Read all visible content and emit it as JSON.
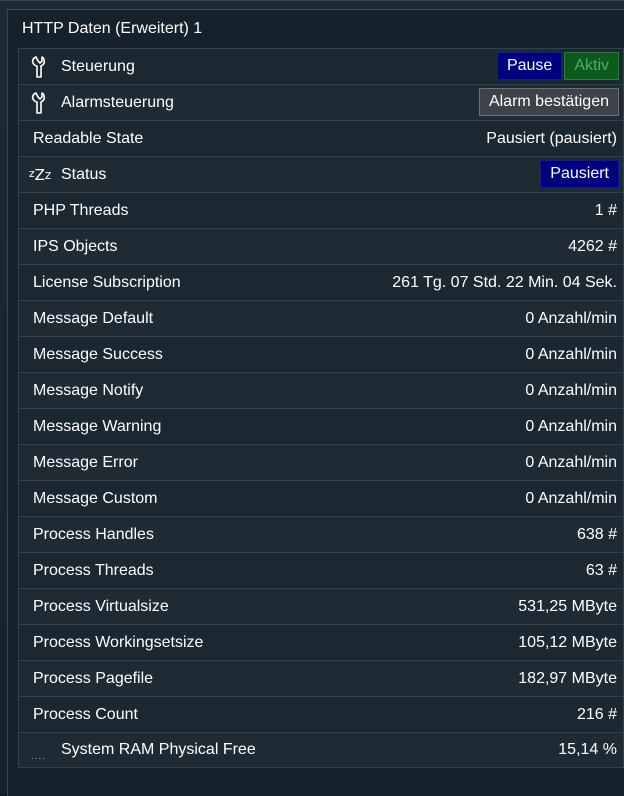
{
  "widget": {
    "title": "HTTP Daten (Erweitert) 1"
  },
  "rows": {
    "steuerung": {
      "label": "Steuerung",
      "icon": "wrench-icon",
      "buttons": {
        "pause": "Pause",
        "aktiv": "Aktiv"
      }
    },
    "alarm": {
      "label": "Alarmsteuerung",
      "icon": "wrench-icon",
      "button": "Alarm bestätigen"
    },
    "readable_state": {
      "label": "Readable State",
      "value": "Pausiert (pausiert)"
    },
    "status": {
      "label": "Status",
      "icon_text": "zZz",
      "button": "Pausiert"
    },
    "php_threads": {
      "label": "PHP Threads",
      "value": "1 #"
    },
    "ips_objects": {
      "label": "IPS Objects",
      "value": "4262 #"
    },
    "license": {
      "label": "License Subscription",
      "value": "261 Tg. 07 Std. 22 Min. 04 Sek."
    },
    "msg_default": {
      "label": "Message Default",
      "value": "0 Anzahl/min"
    },
    "msg_success": {
      "label": "Message Success",
      "value": "0 Anzahl/min"
    },
    "msg_notify": {
      "label": "Message Notify",
      "value": "0 Anzahl/min"
    },
    "msg_warning": {
      "label": "Message Warning",
      "value": "0 Anzahl/min"
    },
    "msg_error": {
      "label": "Message Error",
      "value": "0 Anzahl/min"
    },
    "msg_custom": {
      "label": "Message Custom",
      "value": "0 Anzahl/min"
    },
    "proc_handles": {
      "label": "Process Handles",
      "value": "638 #"
    },
    "proc_threads": {
      "label": "Process Threads",
      "value": "63 #"
    },
    "proc_virtualsize": {
      "label": "Process Virtualsize",
      "value": "531,25 MByte"
    },
    "proc_workingset": {
      "label": "Process Workingsetsize",
      "value": "105,12 MByte"
    },
    "proc_pagefile": {
      "label": "Process Pagefile",
      "value": "182,97 MByte"
    },
    "proc_count": {
      "label": "Process Count",
      "value": "216 #"
    },
    "ram_free": {
      "label": "System RAM Physical Free",
      "value": "15,14 %",
      "icon_text": "...."
    }
  },
  "colors": {
    "button_blue": "#00007f",
    "button_green": "#0c5a1c",
    "button_grey": "#3d4348",
    "background": "#1b2731"
  }
}
